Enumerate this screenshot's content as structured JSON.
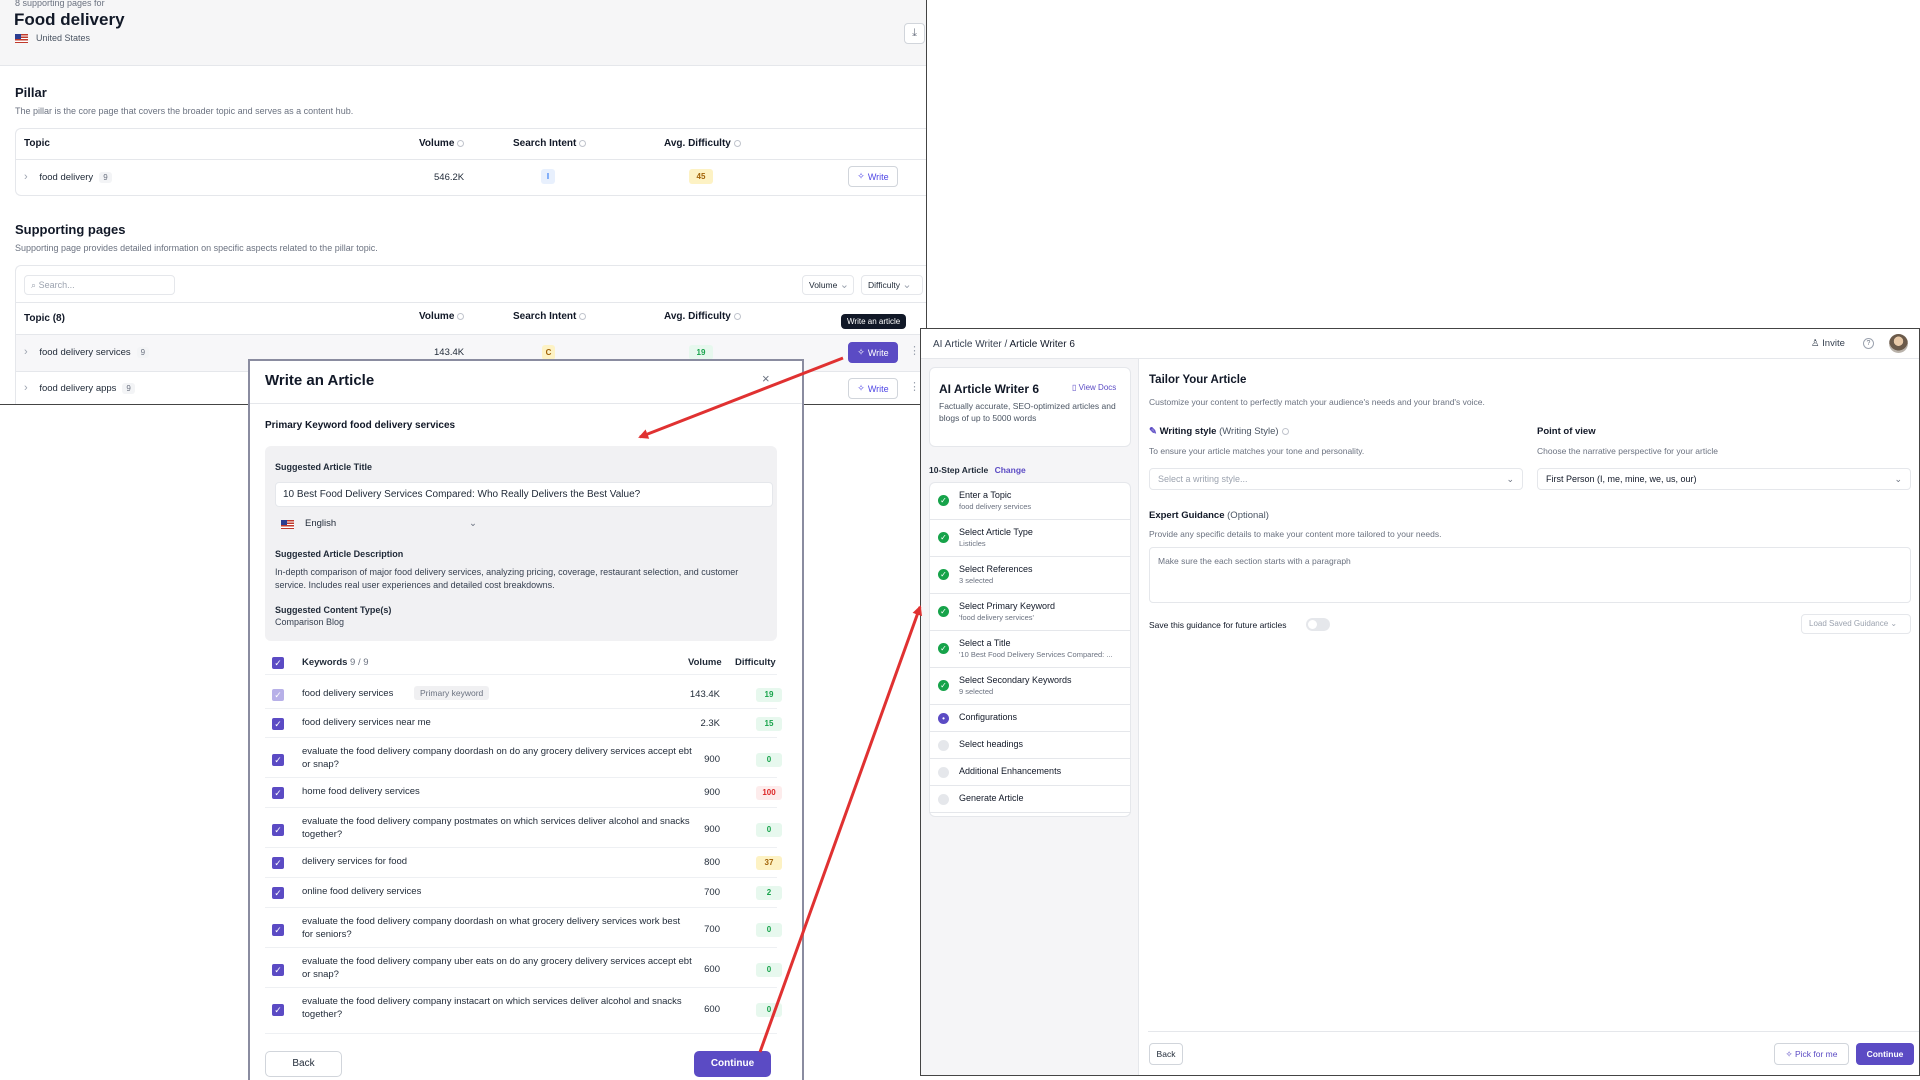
{
  "cluster": {
    "count_label": "8 supporting pages for",
    "title": "Food delivery",
    "country": "United States",
    "pillar": {
      "heading": "Pillar",
      "description": "The pillar is the core page that covers the broader topic and serves as a content hub.",
      "columns": {
        "topic": "Topic",
        "volume": "Volume",
        "intent": "Search Intent",
        "difficulty": "Avg. Difficulty"
      },
      "row": {
        "topic": "food delivery",
        "count": "9",
        "volume": "546.2K",
        "intent": "I",
        "difficulty": "45",
        "write": "Write"
      }
    },
    "supporting": {
      "heading": "Supporting pages",
      "description": "Supporting page provides detailed information on specific aspects related to the pillar topic.",
      "search_placeholder": "Search...",
      "filter_volume": "Volume",
      "filter_difficulty": "Difficulty",
      "columns": {
        "topic": "Topic (8)",
        "volume": "Volume",
        "intent": "Search Intent",
        "difficulty": "Avg. Difficulty"
      },
      "tooltip": "Write an article",
      "rows": [
        {
          "topic": "food delivery services",
          "count": "9",
          "volume": "143.4K",
          "intent": "C",
          "difficulty": "19",
          "write": "Write"
        },
        {
          "topic": "food delivery apps",
          "count": "9",
          "write": "Write"
        }
      ]
    }
  },
  "modal": {
    "title": "Write an Article",
    "primary_keyword_label": "Primary Keyword",
    "primary_keyword": "food delivery services",
    "suggested_title_label": "Suggested Article Title",
    "suggested_title": "10 Best Food Delivery Services Compared: Who Really Delivers the Best Value?",
    "language": "English",
    "description_label": "Suggested Article Description",
    "description": "In-depth comparison of major food delivery services, analyzing pricing, coverage, restaurant selection, and customer service. Includes real user experiences and detailed cost breakdowns.",
    "content_type_label": "Suggested Content Type(s)",
    "content_type": "Comparison Blog",
    "keywords_header": "Keywords",
    "keywords_count": "9 / 9",
    "volume_header": "Volume",
    "difficulty_header": "Difficulty",
    "primary_badge": "Primary keyword",
    "keywords": [
      {
        "text": "food delivery services",
        "volume": "143.4K",
        "difficulty": "19",
        "level": "g"
      },
      {
        "text": "food delivery services near me",
        "volume": "2.3K",
        "difficulty": "15",
        "level": "g"
      },
      {
        "text": "evaluate the food delivery company doordash on do any grocery delivery services accept ebt or snap?",
        "volume": "900",
        "difficulty": "0",
        "level": "g"
      },
      {
        "text": "home food delivery services",
        "volume": "900",
        "difficulty": "100",
        "level": "r"
      },
      {
        "text": "evaluate the food delivery company postmates on which services deliver alcohol and snacks together?",
        "volume": "900",
        "difficulty": "0",
        "level": "g"
      },
      {
        "text": "delivery services for food",
        "volume": "800",
        "difficulty": "37",
        "level": "y"
      },
      {
        "text": "online food delivery services",
        "volume": "700",
        "difficulty": "2",
        "level": "g"
      },
      {
        "text": "evaluate the food delivery company doordash on what grocery delivery services work best for seniors?",
        "volume": "700",
        "difficulty": "0",
        "level": "g"
      },
      {
        "text": "evaluate the food delivery company uber eats on do any grocery delivery services accept ebt or snap?",
        "volume": "600",
        "difficulty": "0",
        "level": "g"
      },
      {
        "text": "evaluate the food delivery company instacart on which services deliver alcohol and snacks together?",
        "volume": "600",
        "difficulty": "0",
        "level": "g"
      }
    ],
    "back": "Back",
    "continue": "Continue"
  },
  "writer": {
    "breadcrumb_root": "AI Article Writer",
    "breadcrumb_current": "Article Writer 6",
    "invite": "Invite",
    "card_title": "AI Article Writer 6",
    "view_docs": "View Docs",
    "card_desc": "Factually accurate, SEO-optimized articles and blogs of up to 5000 words",
    "steps_label": "10-Step Article",
    "change": "Change",
    "steps": [
      {
        "title": "Enter a Topic",
        "sub": "food delivery services",
        "state": "done"
      },
      {
        "title": "Select Article Type",
        "sub": "Listicles",
        "state": "done"
      },
      {
        "title": "Select References",
        "sub": "3 selected",
        "state": "done"
      },
      {
        "title": "Select Primary Keyword",
        "sub": "'food delivery services'",
        "state": "done"
      },
      {
        "title": "Select a Title",
        "sub": "'10 Best Food Delivery Services Compared: ...",
        "state": "done"
      },
      {
        "title": "Select Secondary Keywords",
        "sub": "9 selected",
        "state": "done"
      },
      {
        "title": "Configurations",
        "sub": "",
        "state": "current"
      },
      {
        "title": "Select headings",
        "sub": "",
        "state": "pending"
      },
      {
        "title": "Additional Enhancements",
        "sub": "",
        "state": "pending"
      },
      {
        "title": "Generate Article",
        "sub": "",
        "state": "pending"
      }
    ],
    "tailor_title": "Tailor Your Article",
    "tailor_desc": "Customize your content to perfectly match your audience's needs and your brand's voice.",
    "writing_style_label": "Writing style",
    "writing_style_paren": "(Writing Style)",
    "writing_style_desc": "To ensure your article matches your tone and personality.",
    "writing_style_placeholder": "Select a writing style...",
    "pov_label": "Point of view",
    "pov_desc": "Choose the narrative perspective for your article",
    "pov_value": "First Person (I, me, mine, we, us, our)",
    "guidance_label": "Expert Guidance",
    "guidance_optional": "(Optional)",
    "guidance_desc": "Provide any specific details to make your content more tailored to your needs.",
    "guidance_text": "Make sure the each section starts with a paragraph",
    "save_guidance": "Save this guidance for future articles",
    "load_saved": "Load Saved Guidance",
    "back": "Back",
    "pick_for_me": "Pick for me",
    "continue": "Continue"
  }
}
